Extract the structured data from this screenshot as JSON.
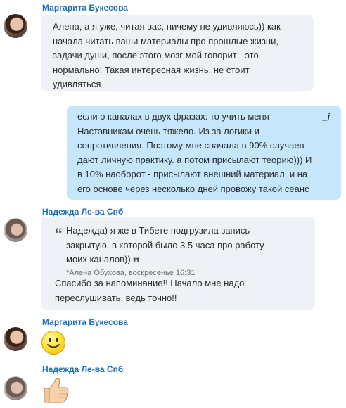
{
  "messages": [
    {
      "sender": "Маргарита Букесова",
      "text_lines": [
        "Алена, а я уже, читая вас, ничему не удивляюсь)) как",
        "начала читать ваши материалы про прошлые жизни,",
        "задачи души, после этого мозг мой говорит - это",
        "нормально! Такая интересная жизнь, не стоит",
        "удивляться"
      ]
    },
    {
      "edited_icon": "_i",
      "text_lines": [
        "если о каналах в двух фразах: то учить меня",
        "Наставникам очень тяжело. Из за логики и",
        "сопротивления. Поэтому мне сначала  в 90% случаев",
        "дают личную практику. а потом присылают теорию))) И",
        "в 10% наоборот - присылают внешний материал. и на",
        "его основе через несколько дней провожу такой сеанс"
      ]
    },
    {
      "sender": "Надежда Ле-ва Спб",
      "quote": {
        "open_mark": "“",
        "close_mark": "”",
        "lines": [
          "Надежда) я же в Тибете подгрузила запись",
          "закрытую. в которой было 3.5 часа про работу",
          "моих каналов))"
        ],
        "meta": "*Алена Обухова, воскресенье 16:31"
      },
      "text_lines": [
        "Спасибо за напоминание!! Начало мне надо",
        "переслушивать, ведь точно!!"
      ]
    },
    {
      "sender": "Маргарита Букесова",
      "emoticon": "smiley-emoticon"
    },
    {
      "sender": "Надежда Ле-ва Спб",
      "emoticon": "thumbs-up-emoticon"
    }
  ],
  "colors": {
    "sender": "#1b6fb6",
    "incoming_bubble": "#eef1f6",
    "outgoing_bubble": "#c6e7fb"
  }
}
